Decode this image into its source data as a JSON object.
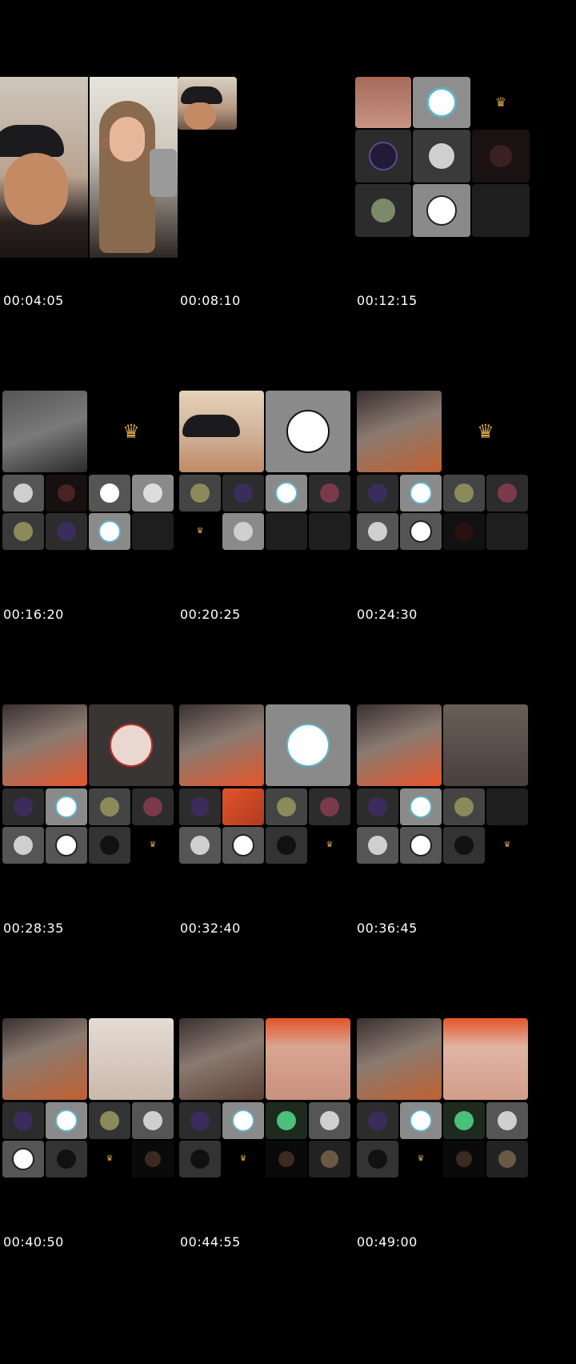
{
  "sheet": {
    "timestamps": [
      "00:04:05",
      "00:08:10",
      "00:12:15",
      "00:16:20",
      "00:20:25",
      "00:24:30",
      "00:28:35",
      "00:32:40",
      "00:36:45",
      "00:40:50",
      "00:44:55",
      "00:49:00"
    ]
  },
  "colors": {
    "background": "#000000",
    "timestamp_text": "#ffffff",
    "crown_gold": "#d6a84a",
    "hair_orange": "#e4552a"
  },
  "icons": {
    "crown": "♛"
  }
}
